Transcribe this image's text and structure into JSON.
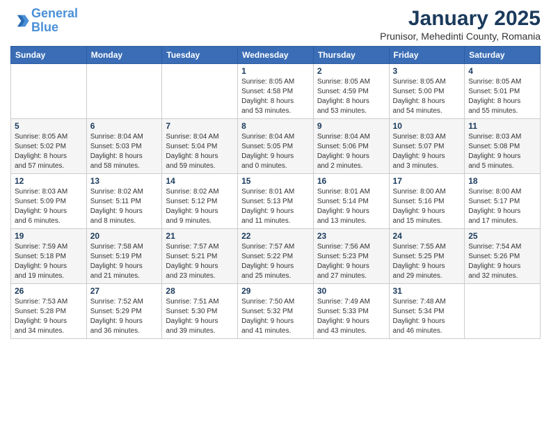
{
  "header": {
    "logo_line1": "General",
    "logo_line2": "Blue",
    "title": "January 2025",
    "subtitle": "Prunisor, Mehedinti County, Romania"
  },
  "days_of_week": [
    "Sunday",
    "Monday",
    "Tuesday",
    "Wednesday",
    "Thursday",
    "Friday",
    "Saturday"
  ],
  "weeks": [
    [
      {
        "day": "",
        "info": ""
      },
      {
        "day": "",
        "info": ""
      },
      {
        "day": "",
        "info": ""
      },
      {
        "day": "1",
        "info": "Sunrise: 8:05 AM\nSunset: 4:58 PM\nDaylight: 8 hours\nand 53 minutes."
      },
      {
        "day": "2",
        "info": "Sunrise: 8:05 AM\nSunset: 4:59 PM\nDaylight: 8 hours\nand 53 minutes."
      },
      {
        "day": "3",
        "info": "Sunrise: 8:05 AM\nSunset: 5:00 PM\nDaylight: 8 hours\nand 54 minutes."
      },
      {
        "day": "4",
        "info": "Sunrise: 8:05 AM\nSunset: 5:01 PM\nDaylight: 8 hours\nand 55 minutes."
      }
    ],
    [
      {
        "day": "5",
        "info": "Sunrise: 8:05 AM\nSunset: 5:02 PM\nDaylight: 8 hours\nand 57 minutes."
      },
      {
        "day": "6",
        "info": "Sunrise: 8:04 AM\nSunset: 5:03 PM\nDaylight: 8 hours\nand 58 minutes."
      },
      {
        "day": "7",
        "info": "Sunrise: 8:04 AM\nSunset: 5:04 PM\nDaylight: 8 hours\nand 59 minutes."
      },
      {
        "day": "8",
        "info": "Sunrise: 8:04 AM\nSunset: 5:05 PM\nDaylight: 9 hours\nand 0 minutes."
      },
      {
        "day": "9",
        "info": "Sunrise: 8:04 AM\nSunset: 5:06 PM\nDaylight: 9 hours\nand 2 minutes."
      },
      {
        "day": "10",
        "info": "Sunrise: 8:03 AM\nSunset: 5:07 PM\nDaylight: 9 hours\nand 3 minutes."
      },
      {
        "day": "11",
        "info": "Sunrise: 8:03 AM\nSunset: 5:08 PM\nDaylight: 9 hours\nand 5 minutes."
      }
    ],
    [
      {
        "day": "12",
        "info": "Sunrise: 8:03 AM\nSunset: 5:09 PM\nDaylight: 9 hours\nand 6 minutes."
      },
      {
        "day": "13",
        "info": "Sunrise: 8:02 AM\nSunset: 5:11 PM\nDaylight: 9 hours\nand 8 minutes."
      },
      {
        "day": "14",
        "info": "Sunrise: 8:02 AM\nSunset: 5:12 PM\nDaylight: 9 hours\nand 9 minutes."
      },
      {
        "day": "15",
        "info": "Sunrise: 8:01 AM\nSunset: 5:13 PM\nDaylight: 9 hours\nand 11 minutes."
      },
      {
        "day": "16",
        "info": "Sunrise: 8:01 AM\nSunset: 5:14 PM\nDaylight: 9 hours\nand 13 minutes."
      },
      {
        "day": "17",
        "info": "Sunrise: 8:00 AM\nSunset: 5:16 PM\nDaylight: 9 hours\nand 15 minutes."
      },
      {
        "day": "18",
        "info": "Sunrise: 8:00 AM\nSunset: 5:17 PM\nDaylight: 9 hours\nand 17 minutes."
      }
    ],
    [
      {
        "day": "19",
        "info": "Sunrise: 7:59 AM\nSunset: 5:18 PM\nDaylight: 9 hours\nand 19 minutes."
      },
      {
        "day": "20",
        "info": "Sunrise: 7:58 AM\nSunset: 5:19 PM\nDaylight: 9 hours\nand 21 minutes."
      },
      {
        "day": "21",
        "info": "Sunrise: 7:57 AM\nSunset: 5:21 PM\nDaylight: 9 hours\nand 23 minutes."
      },
      {
        "day": "22",
        "info": "Sunrise: 7:57 AM\nSunset: 5:22 PM\nDaylight: 9 hours\nand 25 minutes."
      },
      {
        "day": "23",
        "info": "Sunrise: 7:56 AM\nSunset: 5:23 PM\nDaylight: 9 hours\nand 27 minutes."
      },
      {
        "day": "24",
        "info": "Sunrise: 7:55 AM\nSunset: 5:25 PM\nDaylight: 9 hours\nand 29 minutes."
      },
      {
        "day": "25",
        "info": "Sunrise: 7:54 AM\nSunset: 5:26 PM\nDaylight: 9 hours\nand 32 minutes."
      }
    ],
    [
      {
        "day": "26",
        "info": "Sunrise: 7:53 AM\nSunset: 5:28 PM\nDaylight: 9 hours\nand 34 minutes."
      },
      {
        "day": "27",
        "info": "Sunrise: 7:52 AM\nSunset: 5:29 PM\nDaylight: 9 hours\nand 36 minutes."
      },
      {
        "day": "28",
        "info": "Sunrise: 7:51 AM\nSunset: 5:30 PM\nDaylight: 9 hours\nand 39 minutes."
      },
      {
        "day": "29",
        "info": "Sunrise: 7:50 AM\nSunset: 5:32 PM\nDaylight: 9 hours\nand 41 minutes."
      },
      {
        "day": "30",
        "info": "Sunrise: 7:49 AM\nSunset: 5:33 PM\nDaylight: 9 hours\nand 43 minutes."
      },
      {
        "day": "31",
        "info": "Sunrise: 7:48 AM\nSunset: 5:34 PM\nDaylight: 9 hours\nand 46 minutes."
      },
      {
        "day": "",
        "info": ""
      }
    ]
  ]
}
